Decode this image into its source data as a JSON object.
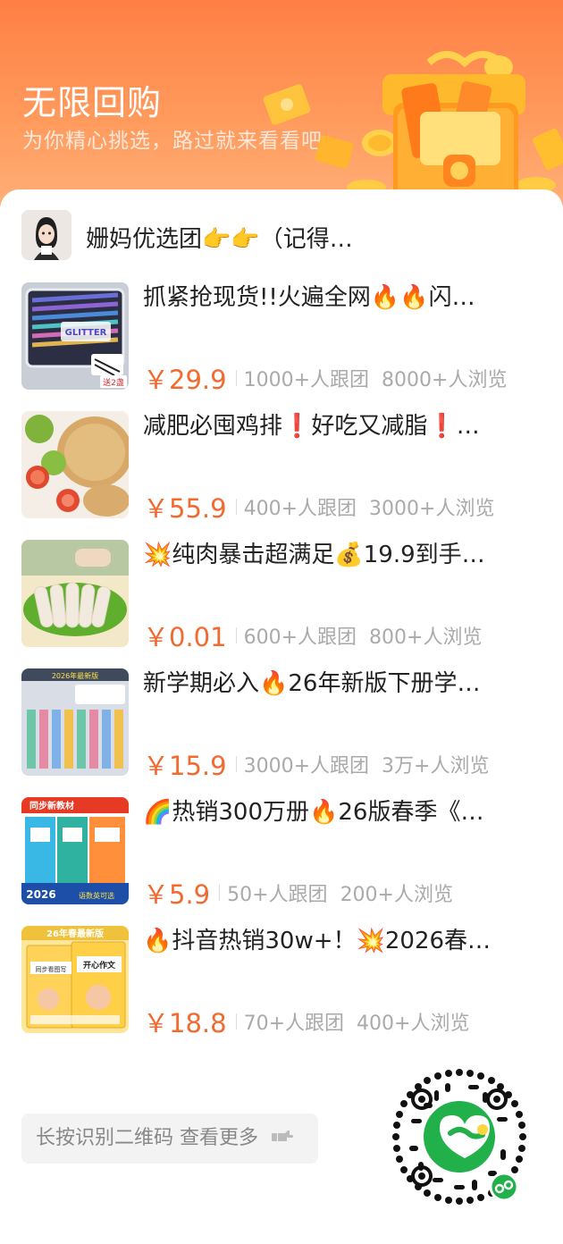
{
  "header": {
    "title": "无限回购",
    "subtitle": "为你精心挑选，路过就来看看吧"
  },
  "group": {
    "name": "姗妈优选团👉👉（记得…"
  },
  "products": [
    {
      "title": "抓紧抢现货!!火遍全网🔥🔥闪…",
      "price": "￥29.9",
      "joined": "1000+人跟团",
      "views": "8000+人浏览",
      "image": "glitter-pens"
    },
    {
      "title": "减肥必囤鸡排❗好吃又减脂❗…",
      "price": "￥55.9",
      "joined": "400+人跟团",
      "views": "3000+人浏览",
      "image": "chicken-cutlet"
    },
    {
      "title": "💥纯肉暴击超满足💰19.9到手…",
      "price": "￥0.01",
      "joined": "600+人跟团",
      "views": "800+人浏览",
      "image": "sausages"
    },
    {
      "title": "新学期必入🔥26年新版下册学…",
      "price": "￥15.9",
      "joined": "3000+人跟团",
      "views": "3万+人浏览",
      "image": "study-cards"
    },
    {
      "title": "🌈热销300万册🔥26版春季《…",
      "price": "￥5.9",
      "joined": "50+人跟团",
      "views": "200+人浏览",
      "image": "textbooks"
    },
    {
      "title": "🔥抖音热销30w+！💥2026春…",
      "price": "￥18.8",
      "joined": "70+人跟团",
      "views": "400+人浏览",
      "image": "composition-books"
    }
  ],
  "thumbnails": {
    "pens_tag": "GLITTER",
    "pens_badge": "送2盏",
    "study_banner": "2026年最新版",
    "textbook_banner": "同步新教材",
    "textbook_year": "2026",
    "textbook_tag": "语数英可选",
    "book1_title": "同步看图写",
    "book2_title": "开心作文",
    "books_banner": "26年春最新版"
  },
  "footer": {
    "more_label": "长按识别二维码 查看更多"
  },
  "colors": {
    "accent": "#f26a2f",
    "hero_gradient_top": "#ff7f45",
    "hero_gradient_bottom": "#ffb07a",
    "qr_logo": "#22b04a"
  },
  "icons": {
    "more_arrow": "hand-pointing-right-icon",
    "qr_badge": "mini-program-icon"
  }
}
